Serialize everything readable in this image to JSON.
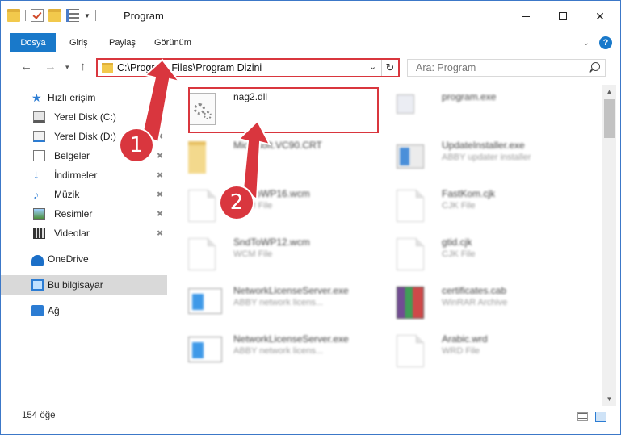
{
  "window": {
    "title": "Program",
    "minimize": "—",
    "maximize": "☐",
    "close": "✕"
  },
  "ribbon": {
    "tabs": [
      "Dosya",
      "Giriş",
      "Paylaş",
      "Görünüm"
    ],
    "expand_chevron": "⌄",
    "help": "?"
  },
  "nav": {
    "back": "←",
    "forward": "→",
    "recent": "▾",
    "up": "↑",
    "address": "C:\\Program Files\\Program Dizini",
    "address_dropdown": "⌄",
    "refresh": "↻",
    "search_placeholder": "Ara: Program"
  },
  "sidebar": {
    "quick_access": "Hızlı erişim",
    "items": [
      {
        "label": "Yerel Disk (C:)",
        "icon": "drive-c-icon",
        "pinned": true
      },
      {
        "label": "Yerel Disk (D:)",
        "icon": "drive-d-icon",
        "pinned": true
      },
      {
        "label": "Belgeler",
        "icon": "documents-icon",
        "pinned": true
      },
      {
        "label": "İndirmeler",
        "icon": "downloads-icon",
        "pinned": true
      },
      {
        "label": "Müzik",
        "icon": "music-icon",
        "pinned": true
      },
      {
        "label": "Resimler",
        "icon": "pictures-icon",
        "pinned": true
      },
      {
        "label": "Videolar",
        "icon": "videos-icon",
        "pinned": true
      }
    ],
    "onedrive": "OneDrive",
    "this_pc": "Bu bilgisayar",
    "network": "Ağ",
    "pin_glyph": "📌"
  },
  "files": [
    {
      "name": "nag2.dll",
      "type": "",
      "icon": "dll-icon"
    },
    {
      "name": "program.exe",
      "type": "",
      "icon": "setup-icon"
    },
    {
      "name": "Microsoft.VC90.CRT",
      "type": "",
      "icon": "folder-icon"
    },
    {
      "name": "UpdateInstaller.exe",
      "type": "ABBY updater installer",
      "icon": "exe-icon"
    },
    {
      "name": "SndToWP16.wcm",
      "type": "WCM File",
      "icon": "file-icon"
    },
    {
      "name": "FastKom.cjk",
      "type": "CJK File",
      "icon": "file-icon"
    },
    {
      "name": "SndToWP12.wcm",
      "type": "WCM File",
      "icon": "file-icon"
    },
    {
      "name": "gtid.cjk",
      "type": "CJK File",
      "icon": "file-icon"
    },
    {
      "name": "NetworkLicenseServer.exe",
      "type": "ABBY network licens...",
      "icon": "window-icon"
    },
    {
      "name": "certificates.cab",
      "type": "WinRAR Archive",
      "icon": "winrar-icon"
    },
    {
      "name": "NetworkLicenseServer.exe",
      "type": "ABBY network licens...",
      "icon": "window-icon"
    },
    {
      "name": "Arabic.wrd",
      "type": "WRD File",
      "icon": "file-icon"
    }
  ],
  "status": {
    "item_count": "154 öğe"
  },
  "annotations": {
    "step1": "1",
    "step2": "2",
    "color": "#d9363e"
  }
}
